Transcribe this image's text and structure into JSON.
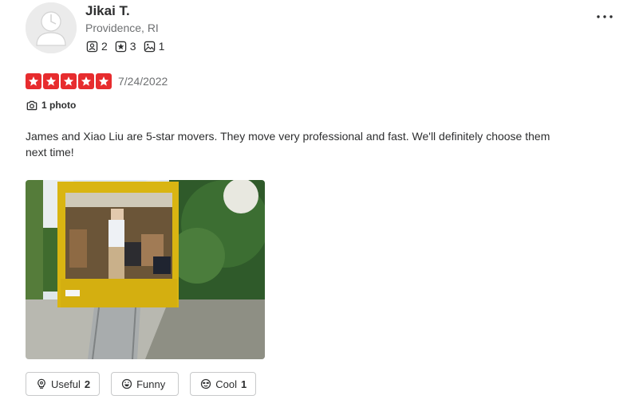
{
  "reviewer": {
    "name": "Jikai T.",
    "location": "Providence, RI",
    "stats": [
      {
        "icon": "friends-icon",
        "value": "2"
      },
      {
        "icon": "reviews-icon",
        "value": "3"
      },
      {
        "icon": "photos-icon",
        "value": "1"
      }
    ]
  },
  "review": {
    "rating": 5,
    "rating_max": 5,
    "date": "7/24/2022",
    "photo_count": "1 photo",
    "text": "James and Xiao Liu are 5-star movers. They move very professional and fast. We'll definitely choose them next time!"
  },
  "actions": {
    "useful": {
      "label": "Useful",
      "count": "2"
    },
    "funny": {
      "label": "Funny",
      "count": ""
    },
    "cool": {
      "label": "Cool",
      "count": "1"
    }
  },
  "colors": {
    "star_red": "#e72c2e",
    "text": "#2d2e2f",
    "muted": "#6e7072",
    "border": "#c8c9ca"
  }
}
